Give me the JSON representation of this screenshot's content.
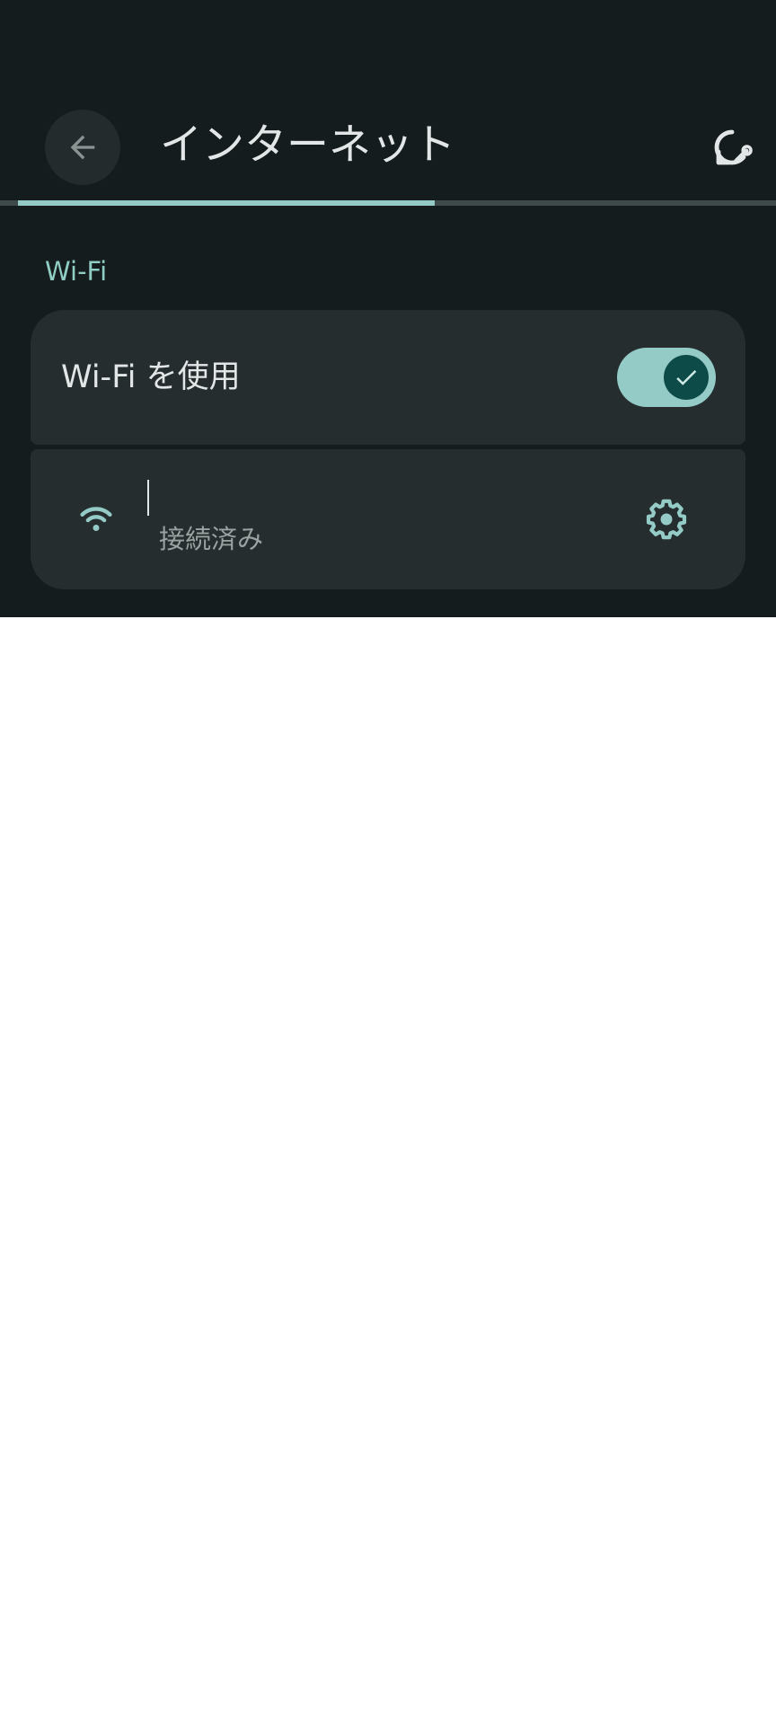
{
  "header": {
    "title": "インターネット",
    "back_icon": "arrow-back-icon",
    "action_icon": "network-reset-icon"
  },
  "progress": {
    "fraction": 0.55
  },
  "wifi_section": {
    "label": "Wi-Fi",
    "toggle": {
      "label": "Wi-Fi を使用",
      "checked": true
    },
    "network": {
      "name": "",
      "status": "接続済み",
      "settings_icon": "gear-icon"
    }
  },
  "colors": {
    "background": "#141c1d",
    "card": "#252d2e",
    "accent": "#94cbc7",
    "text": "#e3e6e6",
    "secondary_text": "#9aa3a2"
  }
}
